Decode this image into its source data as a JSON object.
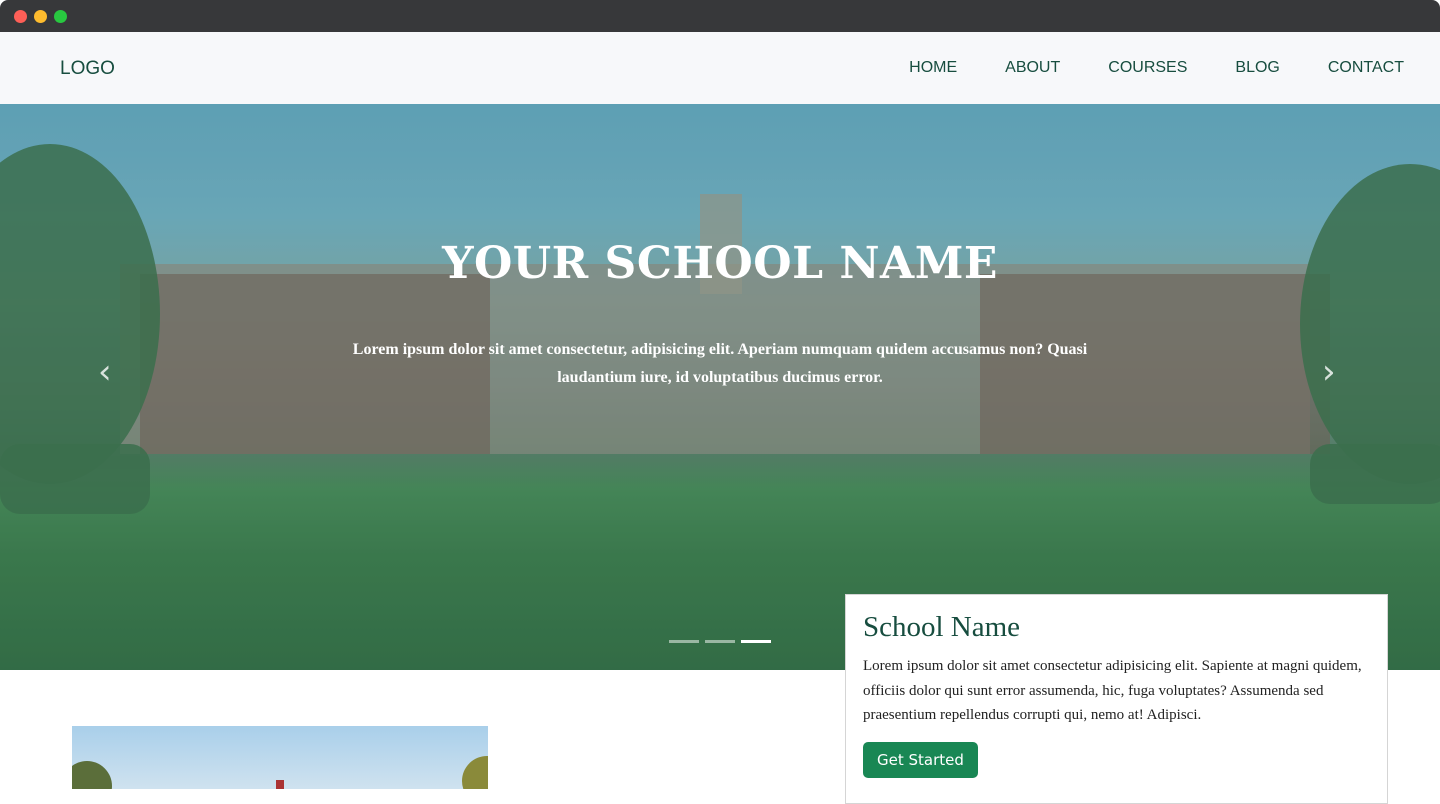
{
  "window": {
    "controls": [
      "close",
      "minimize",
      "maximize"
    ],
    "colors": {
      "close": "#fe5f57",
      "minimize": "#febc2e",
      "maximize": "#28c840"
    }
  },
  "navbar": {
    "logo": "LOGO",
    "items": [
      {
        "label": "HOME"
      },
      {
        "label": "ABOUT"
      },
      {
        "label": "COURSES"
      },
      {
        "label": "BLOG"
      },
      {
        "label": "CONTACT"
      }
    ]
  },
  "hero": {
    "title": "YOUR SCHOOL NAME",
    "subtitle": "Lorem ipsum dolor sit amet consectetur, adipisicing elit. Aperiam numquam quidem accusamus non? Quasi laudantium iure, id voluptatibus ducimus error.",
    "prev_icon": "chevron-left-icon",
    "next_icon": "chevron-right-icon",
    "slides": 3,
    "active_slide": 3
  },
  "card": {
    "title": "School Name",
    "text": "Lorem ipsum dolor sit amet consectetur adipisicing elit. Sapiente at magni quidem, officiis dolor qui sunt error assumenda, hic, fuga voluptates? Assumenda sed praesentium repellendus corrupti qui, nemo at! Adipisci.",
    "button": "Get Started",
    "accent": "#198754"
  }
}
